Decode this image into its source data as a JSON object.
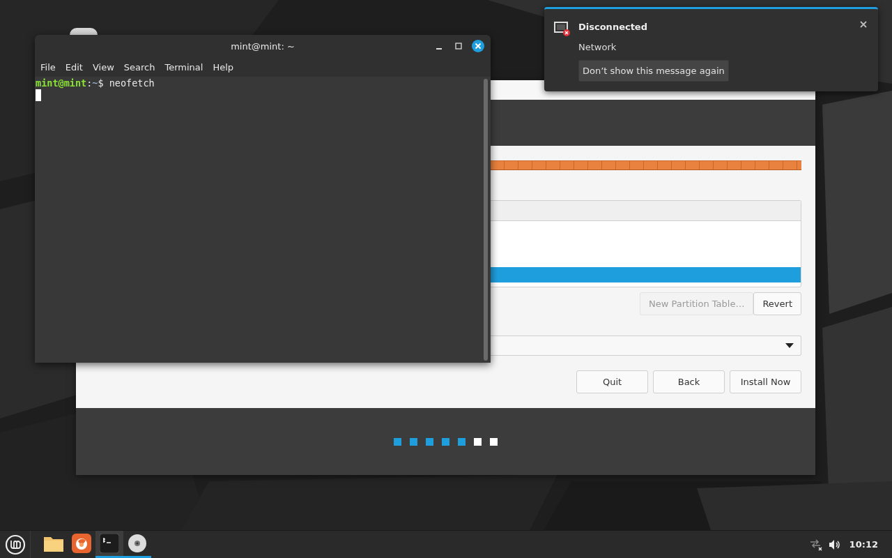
{
  "terminal": {
    "title": "mint@mint: ~",
    "menu": [
      "File",
      "Edit",
      "View",
      "Search",
      "Terminal",
      "Help"
    ],
    "lines": [
      {
        "segments": [
          {
            "kind": "user",
            "text": "mint@mint"
          },
          {
            "kind": "plain",
            "text": ":"
          },
          {
            "kind": "path",
            "text": "~"
          },
          {
            "kind": "plain",
            "text": "$ neofetch"
          }
        ]
      }
    ]
  },
  "installer": {
    "partition_rows": [
      {
        "selected": true
      }
    ],
    "table_buttons": [
      {
        "label": "New Partition Table…",
        "disabled": true
      },
      {
        "label": "Revert",
        "disabled": false
      }
    ],
    "buttons": [
      "Quit",
      "Back",
      "Install Now"
    ],
    "steps": [
      {
        "done": true
      },
      {
        "done": true
      },
      {
        "done": true
      },
      {
        "done": true
      },
      {
        "done": true
      },
      {
        "done": false
      },
      {
        "done": false
      }
    ]
  },
  "notification": {
    "title": "Disconnected",
    "body": "Network",
    "action": "Don’t show this message again"
  },
  "taskbar": {
    "apps": [
      {
        "kind": "folder",
        "active": false,
        "running": false
      },
      {
        "kind": "browser",
        "active": false,
        "running": false
      },
      {
        "kind": "terminal",
        "active": true,
        "running": true
      },
      {
        "kind": "disc",
        "active": false,
        "running": true
      }
    ],
    "clock": "10:12"
  }
}
